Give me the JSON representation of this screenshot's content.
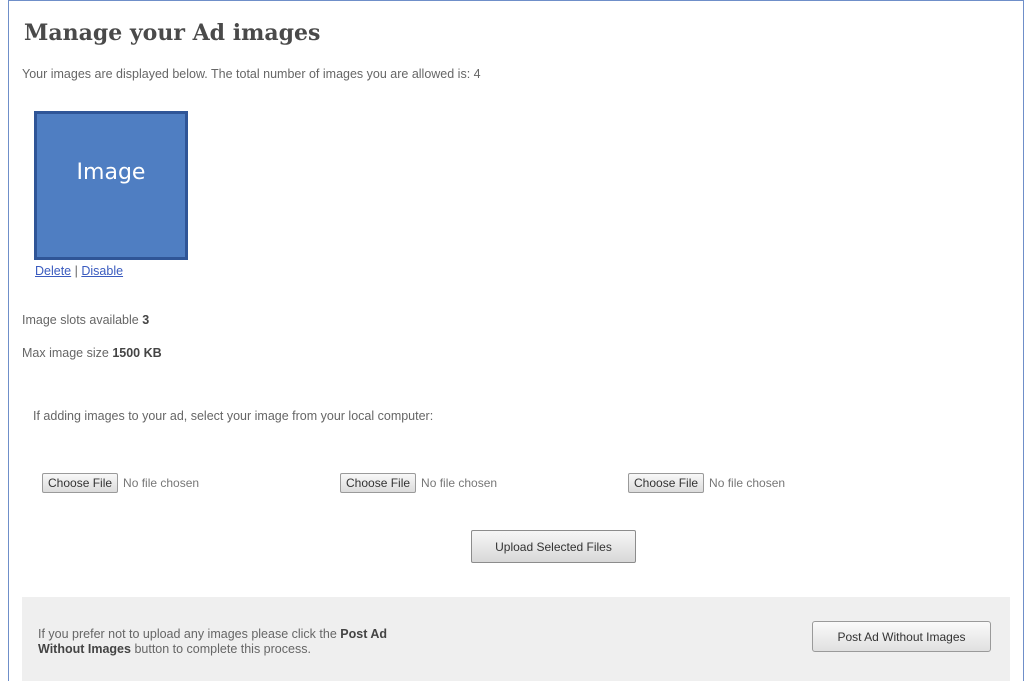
{
  "page": {
    "title": "Manage your Ad images",
    "intro": "Your images are displayed below. The total number of images you are allowed is: 4"
  },
  "image": {
    "placeholder": "Image",
    "delete_label": "Delete",
    "separator": "|",
    "disable_label": "Disable"
  },
  "info": {
    "slots_label": "Image slots available",
    "slots_value": "3",
    "maxsize_label": "Max image size",
    "maxsize_value": "1500 KB"
  },
  "upload": {
    "hint": "If adding images to your ad, select your image from your local computer:",
    "files": [
      {
        "button": "Choose File",
        "status": "No file chosen"
      },
      {
        "button": "Choose File",
        "status": "No file chosen"
      },
      {
        "button": "Choose File",
        "status": "No file chosen"
      }
    ],
    "upload_label": "Upload Selected Files"
  },
  "no_images": {
    "text_before": "If you prefer not to upload any images please click the",
    "text_bold": "Post Ad Without Images",
    "text_after": "button to complete this process.",
    "button_label": "Post Ad Without Images"
  },
  "colors": {
    "image_fill": "#4f7ec2",
    "image_border": "#2f5597",
    "link": "#3a5bbf",
    "panel_bg": "#efefef"
  }
}
